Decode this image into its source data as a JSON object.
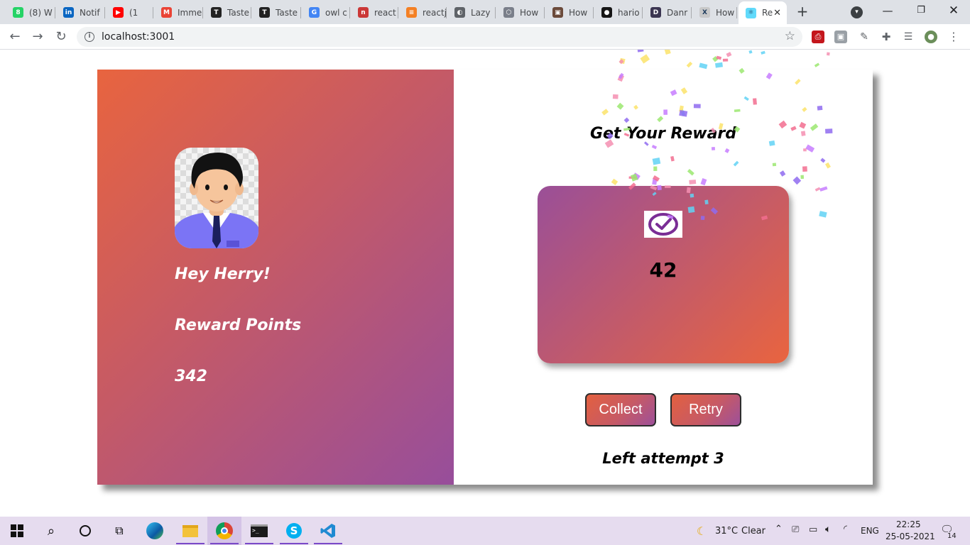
{
  "browser": {
    "tabs": [
      {
        "label": "(8) W",
        "icon": "whatsapp-icon",
        "color": "#25d366",
        "glyph": "8"
      },
      {
        "label": "Notif",
        "icon": "linkedin-icon",
        "color": "#0a66c2",
        "glyph": "in"
      },
      {
        "label": "(1",
        "icon": "youtube-icon",
        "color": "#ff0000",
        "glyph": "▶"
      },
      {
        "label": "Imme",
        "icon": "gmail-icon",
        "color": "#ea4335",
        "glyph": "M"
      },
      {
        "label": "Taste",
        "icon": "t-site-icon",
        "color": "#222222",
        "glyph": "T"
      },
      {
        "label": "Taste",
        "icon": "t-site-icon",
        "color": "#222222",
        "glyph": "T"
      },
      {
        "label": "owl c",
        "icon": "google-icon",
        "color": "#4285f4",
        "glyph": "G"
      },
      {
        "label": "react",
        "icon": "npm-icon",
        "color": "#cb3837",
        "glyph": "n"
      },
      {
        "label": "reactj",
        "icon": "stackoverflow-icon",
        "color": "#f48024",
        "glyph": "≡"
      },
      {
        "label": "Lazy",
        "icon": "globe-icon",
        "color": "#5f6368",
        "glyph": "◐"
      },
      {
        "label": "How",
        "icon": "site-icon",
        "color": "#7a7f8a",
        "glyph": "⬡"
      },
      {
        "label": "How",
        "icon": "image-site-icon",
        "color": "#6b4a3a",
        "glyph": "▣"
      },
      {
        "label": "hario",
        "icon": "github-icon",
        "color": "#161616",
        "glyph": "●"
      },
      {
        "label": "Danr",
        "icon": "dev-icon",
        "color": "#3b3551",
        "glyph": "D"
      },
      {
        "label": "How",
        "icon": "x-site-icon",
        "color": "#c8c8c8",
        "glyph": "X"
      },
      {
        "label": "Re",
        "icon": "react-icon",
        "color": "#61dafb",
        "glyph": "⚛",
        "active": true
      }
    ],
    "url": "localhost:3001"
  },
  "page": {
    "greeting": "Hey Herry!",
    "points_label": "Reward Points",
    "points_value": "342",
    "reward_title": "Get Your Reward",
    "reward_value": "42",
    "collect_label": "Collect",
    "retry_label": "Retry",
    "attempts_text": "Left attempt 3"
  },
  "taskbar": {
    "weather_temp": "31°C",
    "weather_text": "Clear",
    "lang": "ENG",
    "time": "22:25",
    "date": "25-05-2021",
    "notification_count": "14"
  }
}
